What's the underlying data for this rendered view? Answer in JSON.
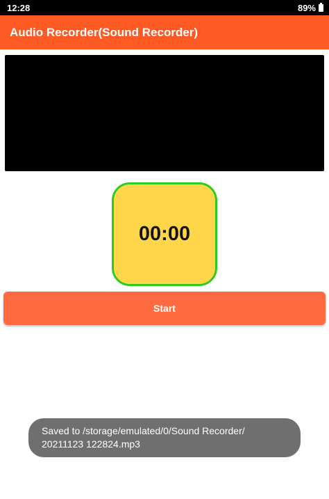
{
  "status_bar": {
    "time": "12:28",
    "battery": "89%"
  },
  "app_bar": {
    "title": "Audio Recorder(Sound Recorder)"
  },
  "timer": {
    "value": "00:00"
  },
  "controls": {
    "start_label": "Start"
  },
  "toast": {
    "line1": "Saved to /storage/emulated/0/Sound Recorder/",
    "line2": "20211123 122824.mp3"
  },
  "colors": {
    "accent": "#ff5a23",
    "button": "#ff6a40",
    "timer_fill": "#ffd54a",
    "timer_border": "#2ecc1f"
  }
}
